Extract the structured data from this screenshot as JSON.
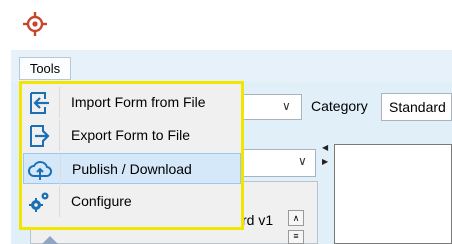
{
  "app": {
    "logo_icon": "crosshair-logo-icon",
    "accent_color": "#c8452a"
  },
  "menubar": {
    "tools_label": "Tools"
  },
  "tools_menu": {
    "highlight_color": "#f2e600",
    "items": [
      {
        "label": "Import Form from File",
        "icon": "import-arrow-icon"
      },
      {
        "label": "Export Form to File",
        "icon": "export-arrow-icon"
      },
      {
        "label": "Publish / Download",
        "icon": "cloud-sync-icon",
        "selected": true
      },
      {
        "label": "Configure",
        "icon": "gears-icon"
      }
    ]
  },
  "background": {
    "category_label": "Category",
    "category_value": "Standard",
    "list_item_text": "rd v1"
  }
}
